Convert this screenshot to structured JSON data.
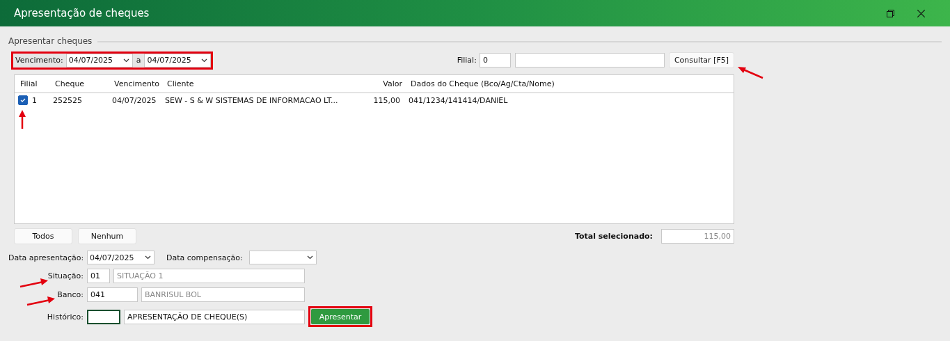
{
  "window": {
    "title": "Apresentação de cheques"
  },
  "section": {
    "title": "Apresentar cheques"
  },
  "filter": {
    "due_label": "Vencimento:",
    "date_from": "04/07/2025",
    "separator": "a",
    "date_to": "04/07/2025",
    "branch_label": "Filial:",
    "branch_code": "0",
    "search_button": "Consultar [F5]"
  },
  "table": {
    "columns": [
      "Filial",
      "Cheque",
      "Vencimento",
      "Cliente",
      "Valor",
      "Dados do Cheque (Bco/Ag/Cta/Nome)"
    ],
    "rows": [
      {
        "checked": true,
        "cells": [
          "1",
          "252525",
          "04/07/2025",
          "SEW - S & W SISTEMAS DE INFORMACAO LT...",
          "115,00",
          "041/1234/141414/DANIEL"
        ]
      }
    ]
  },
  "selection_buttons": [
    "Todos",
    "Nenhum"
  ],
  "total": {
    "label": "Total selecionado:",
    "value": "115,00"
  },
  "form": {
    "presentation_label": "Data apresentação:",
    "presentation_date": "04/07/2025",
    "clearing_label": "Data compensação:",
    "status_label": "Situação:",
    "status_code": "01",
    "status_name": "SITUAÇÃO 1",
    "bank_label": "Banco:",
    "bank_code": "041",
    "bank_name": "BANRISUL BOL",
    "history_label": "Histórico:",
    "history_text": "APRESENTAÇÃO DE CHEQUE(S)"
  },
  "submit_button": "Apresentar"
}
